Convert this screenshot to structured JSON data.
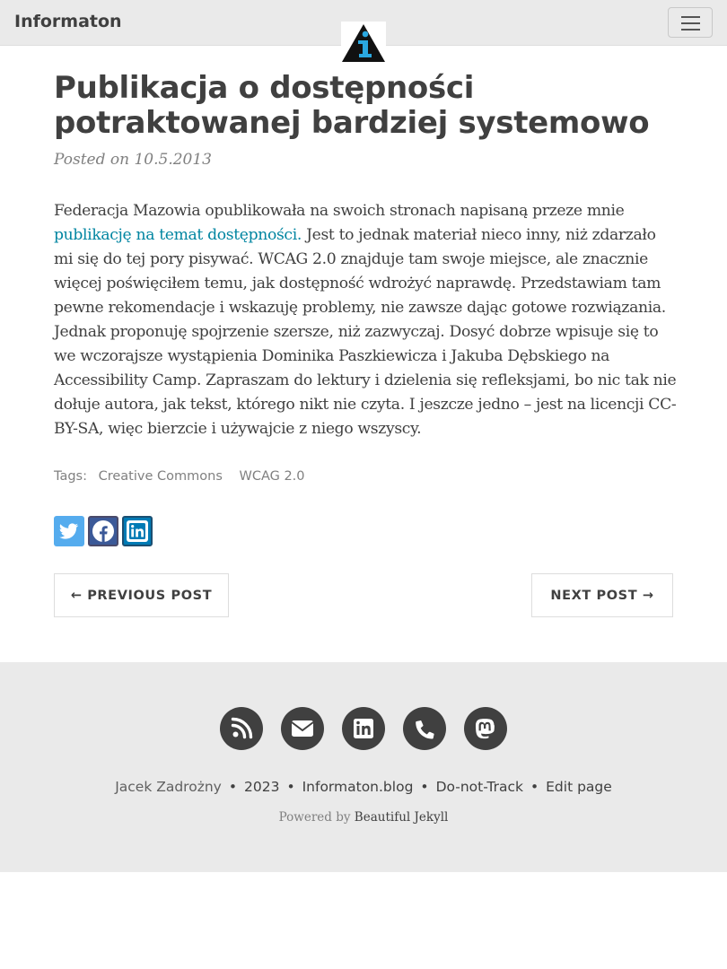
{
  "navbar": {
    "brand": "Informaton",
    "logo_icon": "informaton-logo-icon",
    "menu_icon": "hamburger-menu-icon"
  },
  "post": {
    "title": "Publikacja o dostępności potraktowanej bardziej systemowo",
    "meta": "Posted on 10.5.2013",
    "body_before_link": "Federacja Mazowia opublikowała na swoich stronach napisaną przeze mnie ",
    "body_link": "publikację na temat dostępności.",
    "body_after_link": " Jest to jednak materiał nieco inny, niż zdarzało mi się do tej pory pisywać. WCAG 2.0 znajduje tam swoje miejsce, ale znacznie więcej poświęciłem temu, jak dostępność wdrożyć naprawdę. Przedstawiam tam pewne rekomendacje i wskazuję problemy, nie zawsze dając gotowe rozwiązania. Jednak proponuję spojrzenie szersze, niż zazwyczaj. Dosyć dobrze wpisuje się to we wczorajsze wystąpienia Dominika Paszkiewicza i Jakuba Dębskiego na Accessibility Camp. Zapraszam do lektury i dzielenia się refleksjami, bo nic tak nie dołuje autora, jak tekst, którego nikt nie czyta. I jeszcze jedno – jest na licencji CC-BY-SA, więc bierzcie i używajcie z niego wszyscy.",
    "tags_label": "Tags:",
    "tags": [
      "Creative Commons",
      "WCAG 2.0"
    ],
    "share_icons": [
      "twitter-icon",
      "facebook-icon",
      "linkedin-icon"
    ]
  },
  "pager": {
    "prev": "← PREVIOUS POST",
    "next": "NEXT POST →"
  },
  "footer": {
    "icons": [
      "rss-icon",
      "email-icon",
      "linkedin-icon",
      "phone-icon",
      "mastodon-icon"
    ],
    "author": "Jacek Zadrożny",
    "year": "2023",
    "site": "Informaton.blog",
    "dnt": "Do-not-Track",
    "edit": "Edit page",
    "separator": "•",
    "powered_prefix": "Powered by",
    "powered_link": "Beautiful Jekyll"
  },
  "colors": {
    "navbar_bg": "#eaeaea",
    "link": "#0085a1",
    "text": "#404040",
    "muted": "#808080",
    "twitter": "#55acee",
    "facebook": "#3b5998",
    "linkedin": "#007bb5"
  }
}
